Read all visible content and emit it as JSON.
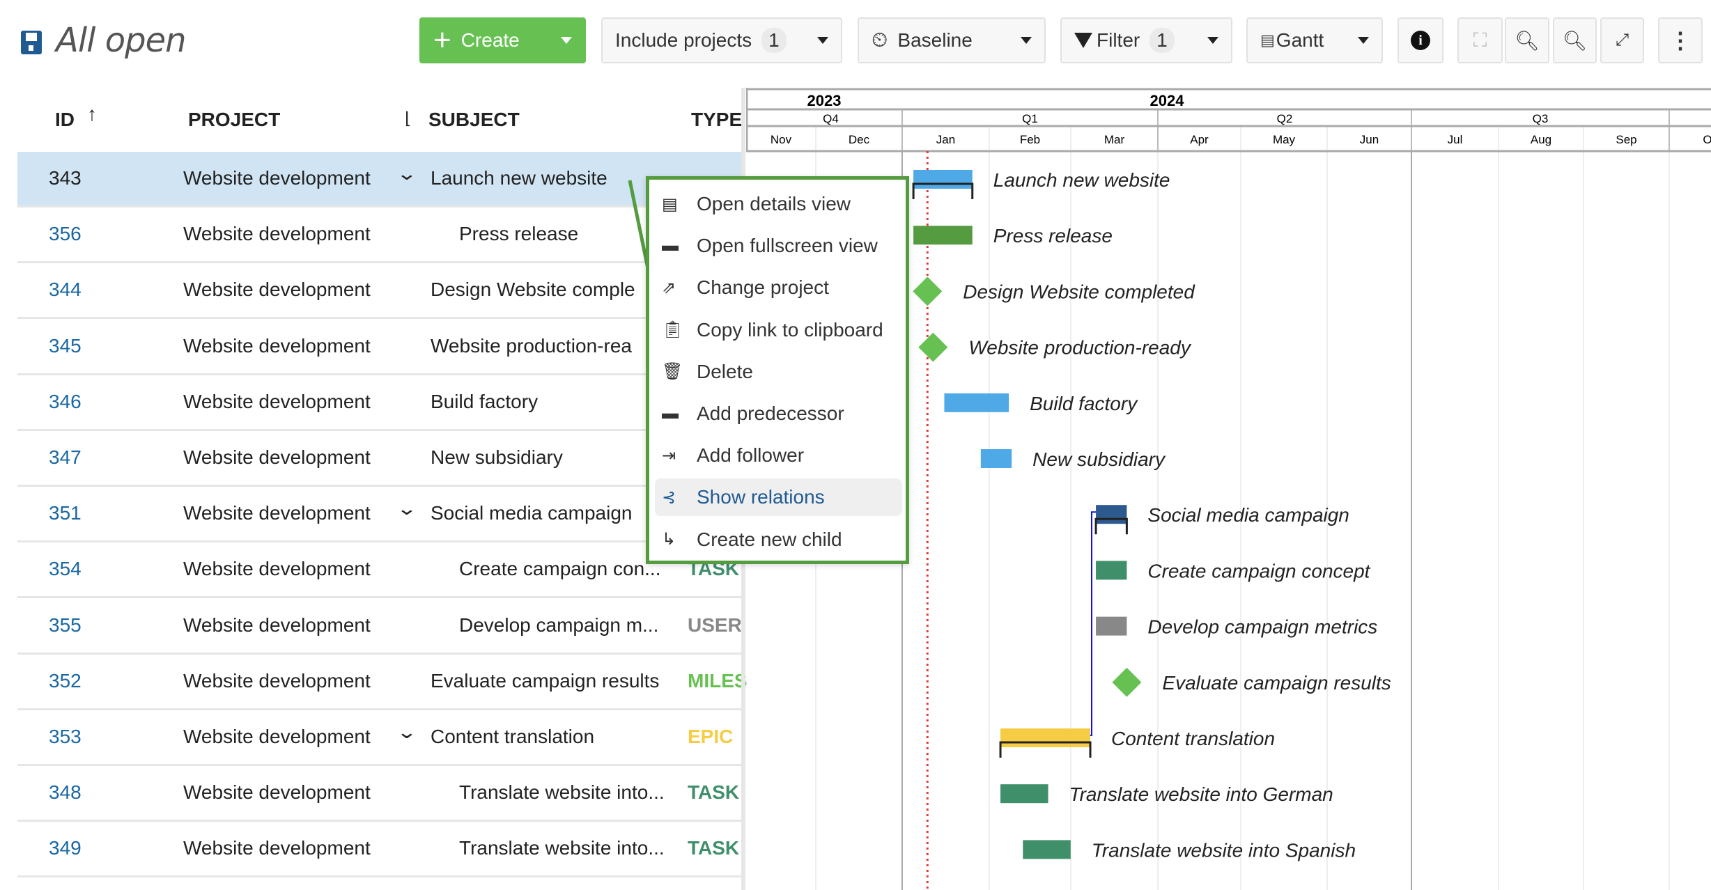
{
  "header": {
    "title": "All open",
    "save_icon": "floppy-disk-icon"
  },
  "toolbar": {
    "create": "Create",
    "include_projects": "Include projects",
    "include_projects_count": "1",
    "baseline": "Baseline",
    "filter": "Filter",
    "filter_count": "1",
    "view": "Gantt",
    "icons": [
      "info-icon",
      "fullscreen-frame-icon",
      "zoom-out-icon",
      "zoom-in-icon",
      "expand-icon",
      "more-vertical-icon"
    ],
    "accent": "#67c152"
  },
  "table": {
    "columns": {
      "id": "ID",
      "project": "PROJECT",
      "subject": "SUBJECT",
      "type": "TYPE"
    },
    "sort": "id-ascending",
    "rows": [
      {
        "id": "343",
        "project": "Website development",
        "subject": "Launch new website",
        "type": "",
        "level": 0,
        "expand": true,
        "selected": true
      },
      {
        "id": "356",
        "project": "Website development",
        "subject": "Press release",
        "type": "",
        "level": 1
      },
      {
        "id": "344",
        "project": "Website development",
        "subject": "Design Website comple",
        "type": "",
        "level": 0
      },
      {
        "id": "345",
        "project": "Website development",
        "subject": "Website production-rea",
        "type": "",
        "level": 0
      },
      {
        "id": "346",
        "project": "Website development",
        "subject": "Build factory",
        "type": "",
        "level": 0
      },
      {
        "id": "347",
        "project": "Website development",
        "subject": "New subsidiary",
        "type": "",
        "level": 0
      },
      {
        "id": "351",
        "project": "Website development",
        "subject": "Social media campaign",
        "type": "",
        "level": 0,
        "expand": true
      },
      {
        "id": "354",
        "project": "Website development",
        "subject": "Create campaign con...",
        "type": "TASK",
        "level": 1
      },
      {
        "id": "355",
        "project": "Website development",
        "subject": "Develop campaign m...",
        "type": "USER",
        "level": 1
      },
      {
        "id": "352",
        "project": "Website development",
        "subject": "Evaluate campaign results",
        "type": "MILES",
        "level": 0
      },
      {
        "id": "353",
        "project": "Website development",
        "subject": "Content translation",
        "type": "EPIC",
        "level": 0,
        "expand": true
      },
      {
        "id": "348",
        "project": "Website development",
        "subject": "Translate website into...",
        "type": "TASK",
        "level": 1
      },
      {
        "id": "349",
        "project": "Website development",
        "subject": "Translate website into...",
        "type": "TASK",
        "level": 1
      }
    ],
    "type_colors": {
      "TASK": "#3f8f6a",
      "USER": "#888888",
      "MILES": "#67c152",
      "EPIC": "#f5cc44"
    }
  },
  "gantt": {
    "years": [
      "2023",
      "2024"
    ],
    "quarters": [
      "Q4",
      "Q1",
      "Q2",
      "Q3"
    ],
    "months": [
      "Nov",
      "Dec",
      "Jan",
      "Feb",
      "Mar",
      "Apr",
      "May",
      "Jun",
      "Jul",
      "Aug",
      "Sep",
      "O"
    ],
    "today": "2024-01-10",
    "items": [
      {
        "label": "Launch new website",
        "kind": "parent",
        "start": "2024-01-05",
        "end": "2024-01-26",
        "color": "#4ea9e6"
      },
      {
        "label": "Press release",
        "kind": "bar",
        "start": "2024-01-05",
        "end": "2024-01-26",
        "color": "#559b3f"
      },
      {
        "label": "Design Website completed",
        "kind": "milestone",
        "start": "2024-01-10",
        "color": "#67c152"
      },
      {
        "label": "Website production-ready",
        "kind": "milestone",
        "start": "2024-01-12",
        "color": "#67c152"
      },
      {
        "label": "Build factory",
        "kind": "bar",
        "start": "2024-01-16",
        "end": "2024-02-08",
        "color": "#4ea9e6"
      },
      {
        "label": "New subsidiary",
        "kind": "bar",
        "start": "2024-01-29",
        "end": "2024-02-09",
        "color": "#4ea9e6"
      },
      {
        "label": "Social media campaign",
        "kind": "parent",
        "start": "2024-03-10",
        "end": "2024-03-21",
        "color": "#2c5a8f"
      },
      {
        "label": "Create campaign concept",
        "kind": "bar",
        "start": "2024-03-10",
        "end": "2024-03-21",
        "color": "#3f8f6a"
      },
      {
        "label": "Develop campaign metrics",
        "kind": "bar",
        "start": "2024-03-10",
        "end": "2024-03-21",
        "color": "#888888"
      },
      {
        "label": "Evaluate campaign results",
        "kind": "milestone",
        "start": "2024-03-21",
        "color": "#67c152"
      },
      {
        "label": "Content translation",
        "kind": "parent",
        "start": "2024-02-05",
        "end": "2024-03-08",
        "color": "#f5cc44"
      },
      {
        "label": "Translate website into German",
        "kind": "bar",
        "start": "2024-02-05",
        "end": "2024-02-22",
        "color": "#3f8f6a"
      },
      {
        "label": "Translate website into Spanish",
        "kind": "bar",
        "start": "2024-02-13",
        "end": "2024-03-01",
        "color": "#3f8f6a"
      }
    ],
    "relation": {
      "from": "Content translation",
      "to": "Social media campaign",
      "color": "#1010e0"
    }
  },
  "context_menu": {
    "items": [
      {
        "label": "Open details view",
        "icon": "details-view-icon"
      },
      {
        "label": "Open fullscreen view",
        "icon": "fullscreen-view-icon"
      },
      {
        "label": "Change project",
        "icon": "move-project-icon"
      },
      {
        "label": "Copy link to clipboard",
        "icon": "clipboard-icon"
      },
      {
        "label": "Delete",
        "icon": "trash-icon"
      },
      {
        "label": "Add predecessor",
        "icon": "add-predecessor-icon"
      },
      {
        "label": "Add follower",
        "icon": "add-follower-icon"
      },
      {
        "label": "Show relations",
        "icon": "relations-icon",
        "highlighted": true
      },
      {
        "label": "Create new child",
        "icon": "create-child-icon"
      }
    ],
    "annotation_color": "#559b3f"
  }
}
